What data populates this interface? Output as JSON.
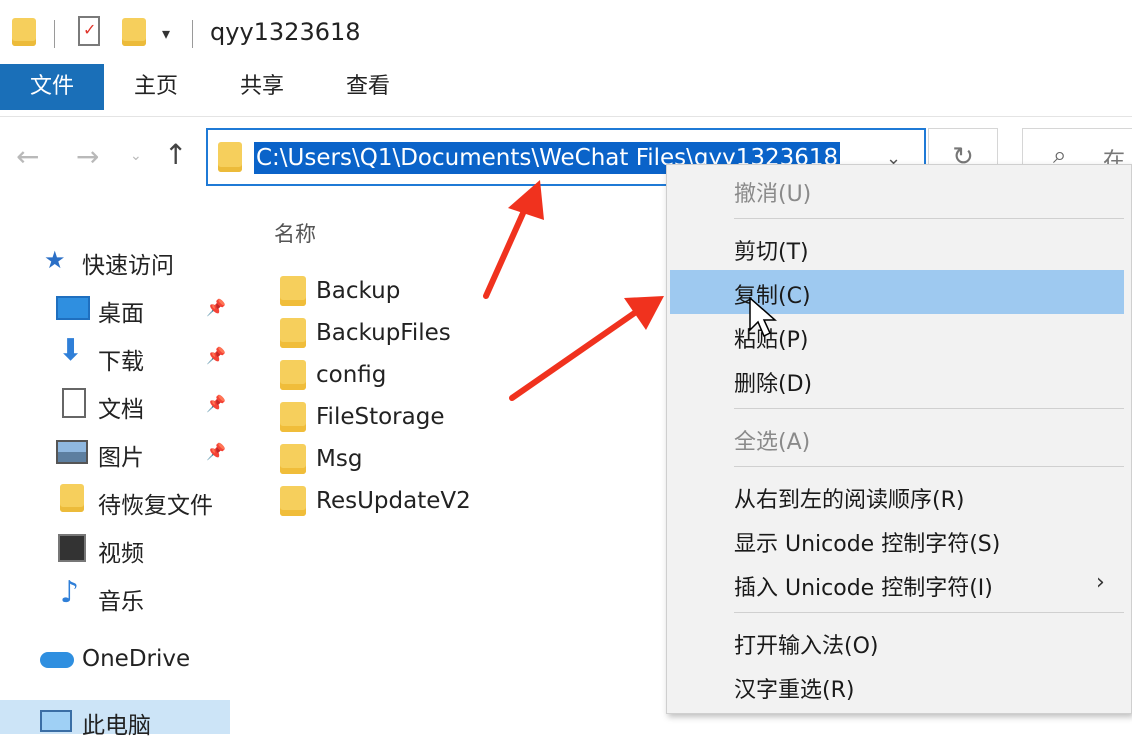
{
  "window": {
    "title": "qyy1323618"
  },
  "ribbon": {
    "tabs": [
      "文件",
      "主页",
      "共享",
      "查看"
    ]
  },
  "address": {
    "path": "C:\\Users\\Q1\\Documents\\WeChat Files\\qyy1323618"
  },
  "search": {
    "placeholder_visible": "在"
  },
  "file_list": {
    "column_name": "名称",
    "items": [
      "Backup",
      "BackupFiles",
      "config",
      "FileStorage",
      "Msg",
      "ResUpdateV2"
    ]
  },
  "sidebar": {
    "quick_access": "快速访问",
    "items": [
      {
        "label": "桌面",
        "icon": "desktop-icon",
        "pinned": true
      },
      {
        "label": "下载",
        "icon": "download-icon",
        "pinned": true
      },
      {
        "label": "文档",
        "icon": "document-icon",
        "pinned": true
      },
      {
        "label": "图片",
        "icon": "picture-icon",
        "pinned": true
      },
      {
        "label": "待恢复文件",
        "icon": "folder-icon",
        "pinned": false
      },
      {
        "label": "视频",
        "icon": "video-icon",
        "pinned": false
      },
      {
        "label": "音乐",
        "icon": "music-icon",
        "pinned": false
      }
    ],
    "onedrive": "OneDrive",
    "this_pc": "此电脑"
  },
  "context_menu": {
    "items": [
      {
        "label": "撤消(U)",
        "enabled": false
      },
      {
        "label": "剪切(T)",
        "enabled": true
      },
      {
        "label": "复制(C)",
        "enabled": true,
        "highlighted": true
      },
      {
        "label": "粘贴(P)",
        "enabled": true
      },
      {
        "label": "删除(D)",
        "enabled": true
      },
      {
        "label": "全选(A)",
        "enabled": false
      },
      {
        "label": "从右到左的阅读顺序(R)",
        "enabled": true
      },
      {
        "label": "显示 Unicode 控制字符(S)",
        "enabled": true
      },
      {
        "label": "插入 Unicode 控制字符(I)",
        "enabled": true,
        "submenu": true
      },
      {
        "label": "打开输入法(O)",
        "enabled": true
      },
      {
        "label": "汉字重选(R)",
        "enabled": true
      }
    ]
  },
  "colors": {
    "accent": "#1a6fb8",
    "selection": "#0a63c9",
    "menu_highlight": "#9ec9f0",
    "annotation_arrow": "#f0321e",
    "folder": "#f6cf5c"
  }
}
